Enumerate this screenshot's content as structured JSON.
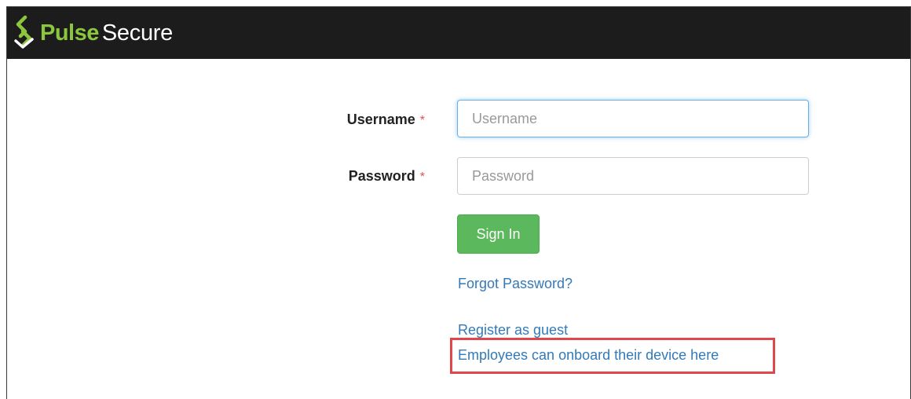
{
  "header": {
    "brand_primary": "Pulse",
    "brand_secondary": "Secure",
    "logo_icon": "pulse-secure-logo-icon",
    "background": "#1c1c1c",
    "brand_color": "#8cc63f"
  },
  "form": {
    "username": {
      "label": "Username",
      "required_marker": "*",
      "placeholder": "Username",
      "value": ""
    },
    "password": {
      "label": "Password",
      "required_marker": "*",
      "placeholder": "Password",
      "value": ""
    },
    "sign_in_label": "Sign In",
    "sign_in_color": "#5cb85c"
  },
  "links": {
    "forgot_password": "Forgot Password?",
    "register_guest": "Register as guest",
    "onboard_device": "Employees can onboard their device here",
    "link_color": "#337ab7"
  },
  "annotation": {
    "highlight_color": "#e0474c"
  }
}
